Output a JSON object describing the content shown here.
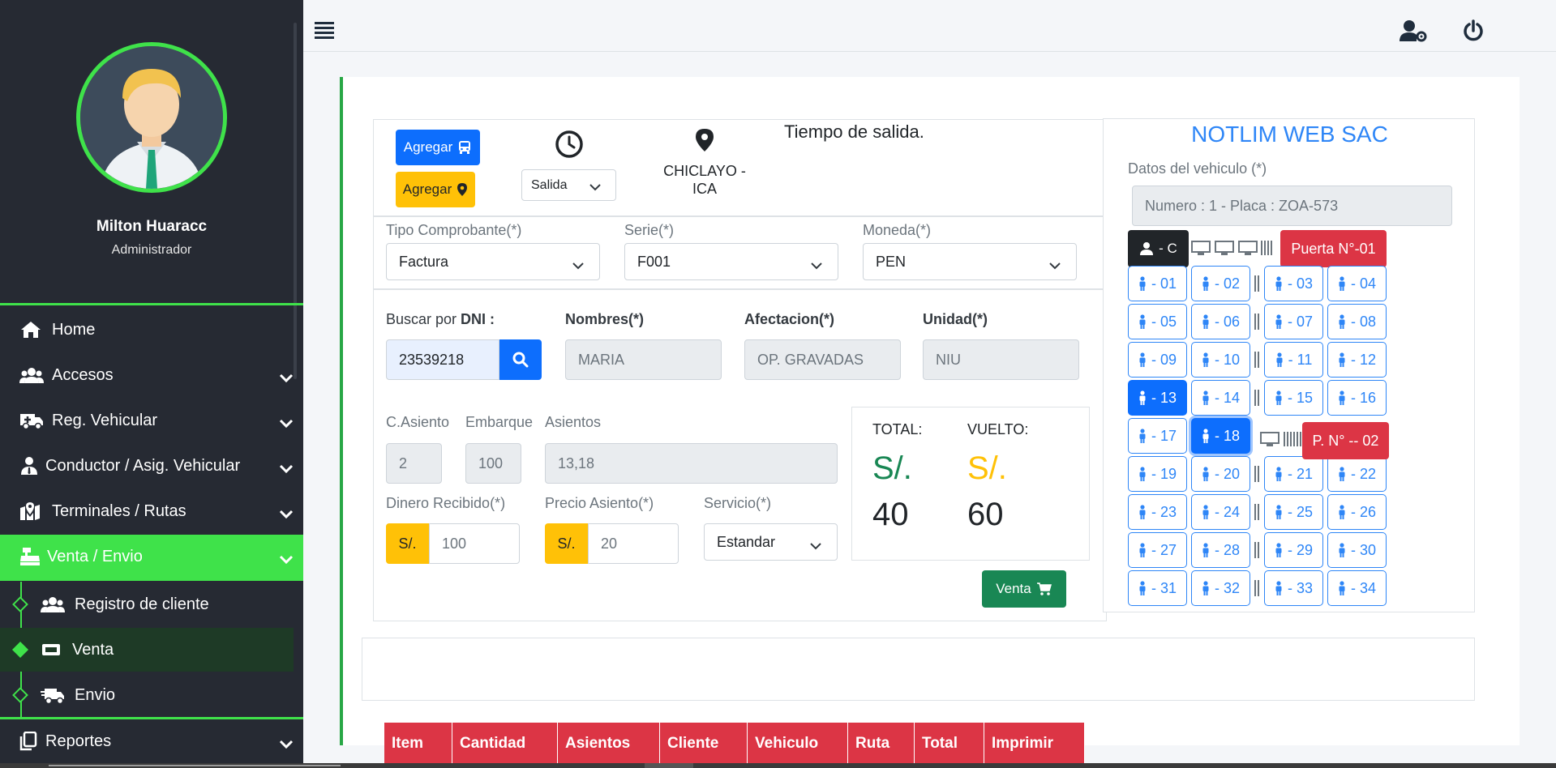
{
  "user": {
    "name": "Milton Huaracc",
    "role": "Administrador"
  },
  "nav": {
    "home": "Home",
    "accesos": "Accesos",
    "reg_vehicular": "Reg. Vehicular",
    "conductor": "Conductor / Asig. Vehicular",
    "terminales": "Terminales / Rutas",
    "venta_envio": "Venta / Envio",
    "registro_cliente": "Registro de cliente",
    "venta": "Venta",
    "envio": "Envio",
    "reportes": "Reportes"
  },
  "header": {
    "add_bus_label": "Agregar",
    "add_place_label": "Agregar",
    "salida_select": "Salida",
    "route": "CHICLAYO - ICA",
    "tiempo_label": "Tiempo de salida."
  },
  "comprobante": {
    "tipo_label": "Tipo Comprobante(*)",
    "tipo_value": "Factura",
    "serie_label": "Serie(*)",
    "serie_value": "F001",
    "moneda_label": "Moneda(*)",
    "moneda_value": "PEN"
  },
  "cliente": {
    "buscar_label_prefix": "Buscar por ",
    "buscar_label_strong": "DNI :",
    "dni_value": "23539218",
    "nombres_label": "Nombres(*)",
    "nombres_value": "MARIA",
    "afectacion_label": "Afectacion(*)",
    "afectacion_value": "OP. GRAVADAS",
    "unidad_label": "Unidad(*)",
    "unidad_value": "NIU"
  },
  "venta": {
    "casiento_label": "C.Asiento",
    "casiento_value": "2",
    "embarque_label": "Embarque",
    "embarque_value": "100",
    "asientos_label": "Asientos",
    "asientos_value": "13,18",
    "dinero_label": "Dinero Recibido(*)",
    "dinero_prefix": "S/.",
    "dinero_value": "100",
    "precio_label": "Precio Asiento(*)",
    "precio_prefix": "S/.",
    "precio_value": "20",
    "servicio_label": "Servicio(*)",
    "servicio_value": "Estandar",
    "submit_label": "Venta"
  },
  "totals": {
    "total_label": "TOTAL:",
    "total_currency": "S/.",
    "total_value": "40",
    "vuelto_label": "VUELTO:",
    "vuelto_currency": "S/.",
    "vuelto_value": "60"
  },
  "vehicle": {
    "company": "NOTLIM WEB SAC",
    "datos_label": "Datos del vehiculo (*)",
    "datos_value": "Numero : 1 -  Placa : ZOA-573",
    "conductor_label": "- C",
    "puerta1": "Puerta N°-01",
    "puerta2": "P. N° -- 02",
    "seats": [
      "- 01",
      "- 02",
      "- 03",
      "- 04",
      "- 05",
      "- 06",
      "- 07",
      "- 08",
      "- 09",
      "- 10",
      "- 11",
      "- 12",
      "- 13",
      "- 14",
      "- 15",
      "- 16",
      "- 17",
      "- 18",
      "- 19",
      "- 20",
      "- 21",
      "- 22",
      "- 23",
      "- 24",
      "- 25",
      "- 26",
      "- 27",
      "- 28",
      "- 29",
      "- 30",
      "- 31",
      "- 32",
      "- 33",
      "- 34"
    ]
  },
  "table": {
    "headers": [
      "Item",
      "Cantidad",
      "Asientos",
      "Cliente",
      "Vehiculo",
      "Ruta",
      "Total",
      "Imprimir"
    ]
  },
  "colors": {
    "accent_green": "#3fe24a",
    "sidebar": "#262a33",
    "primary": "#0d6efd",
    "danger": "#dc3545",
    "warning": "#ffc107",
    "success": "#198754"
  }
}
